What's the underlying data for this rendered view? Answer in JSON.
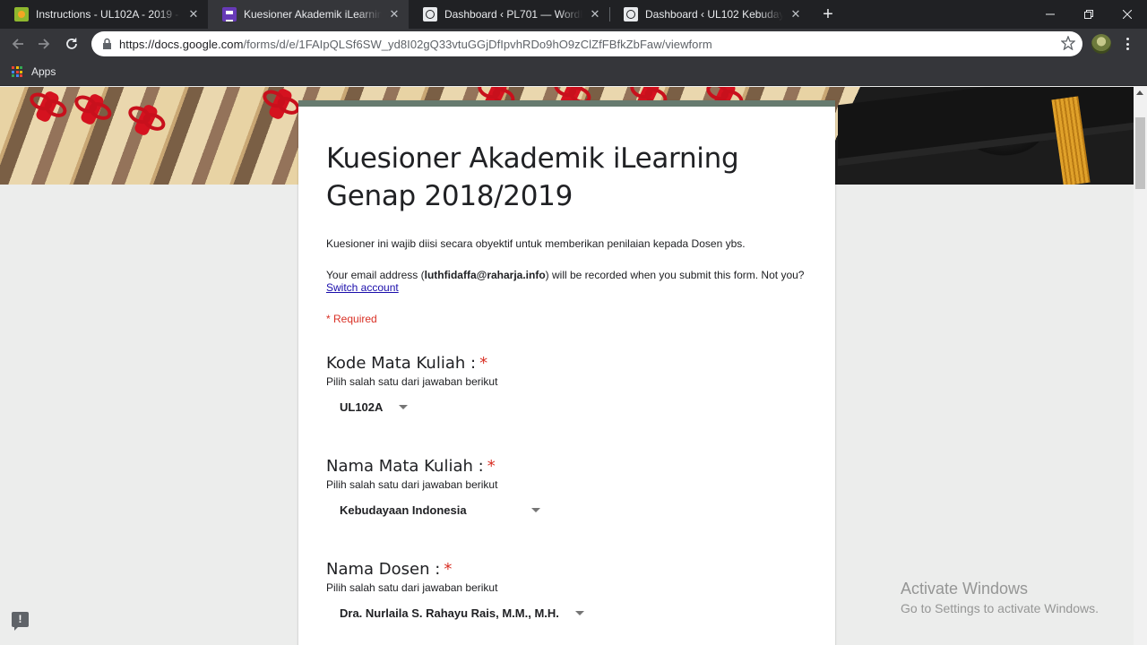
{
  "browser": {
    "tabs": [
      {
        "title": "Instructions - UL102A - 2019 - Pe",
        "icon": "moodle-icon",
        "active": false
      },
      {
        "title": "Kuesioner Akademik iLearning Gen",
        "icon": "google-forms-icon",
        "active": true
      },
      {
        "title": "Dashboard ‹ PL701 — WordPress",
        "icon": "wordpress-icon",
        "active": false
      },
      {
        "title": "Dashboard ‹ UL102 Kebudayaan In",
        "icon": "wordpress-icon",
        "active": false
      }
    ],
    "new_tab": "+",
    "url_host": "https://docs.google.com",
    "url_path": "/forms/d/e/1FAIpQLSf6SW_yd8I02gQ33vtuGGjDfIpvhRDo9hO9zClZfFBfkZbFaw/viewform",
    "bookmarks": {
      "apps_label": "Apps"
    }
  },
  "form": {
    "accent_color": "#677b6f",
    "title": "Kuesioner Akademik iLearning Genap 2018/2019",
    "description": "Kuesioner ini wajib diisi secara obyektif untuk memberikan penilaian kepada Dosen ybs.",
    "email_prefix": "Your email address (",
    "email": "luthfidaffa@raharja.info",
    "email_suffix": ") will be recorded when you submit this form. Not you?",
    "switch_account": "Switch account",
    "required_note": "* Required",
    "questions": [
      {
        "title": "Kode Mata Kuliah :",
        "help": "Pilih salah satu dari jawaban berikut",
        "selected": "UL102A",
        "required": "*"
      },
      {
        "title": "Nama Mata Kuliah :",
        "help": "Pilih salah satu dari jawaban berikut",
        "selected": "Kebudayaan Indonesia",
        "required": "*"
      },
      {
        "title": "Nama Dosen :",
        "help": "Pilih salah satu dari jawaban berikut",
        "selected": "Dra. Nurlaila S. Rahayu Rais, M.M., M.H.",
        "required": "*"
      }
    ]
  },
  "windows_watermark": {
    "line1": "Activate Windows",
    "line2": "Go to Settings to activate Windows."
  },
  "feedback_icon": "!"
}
